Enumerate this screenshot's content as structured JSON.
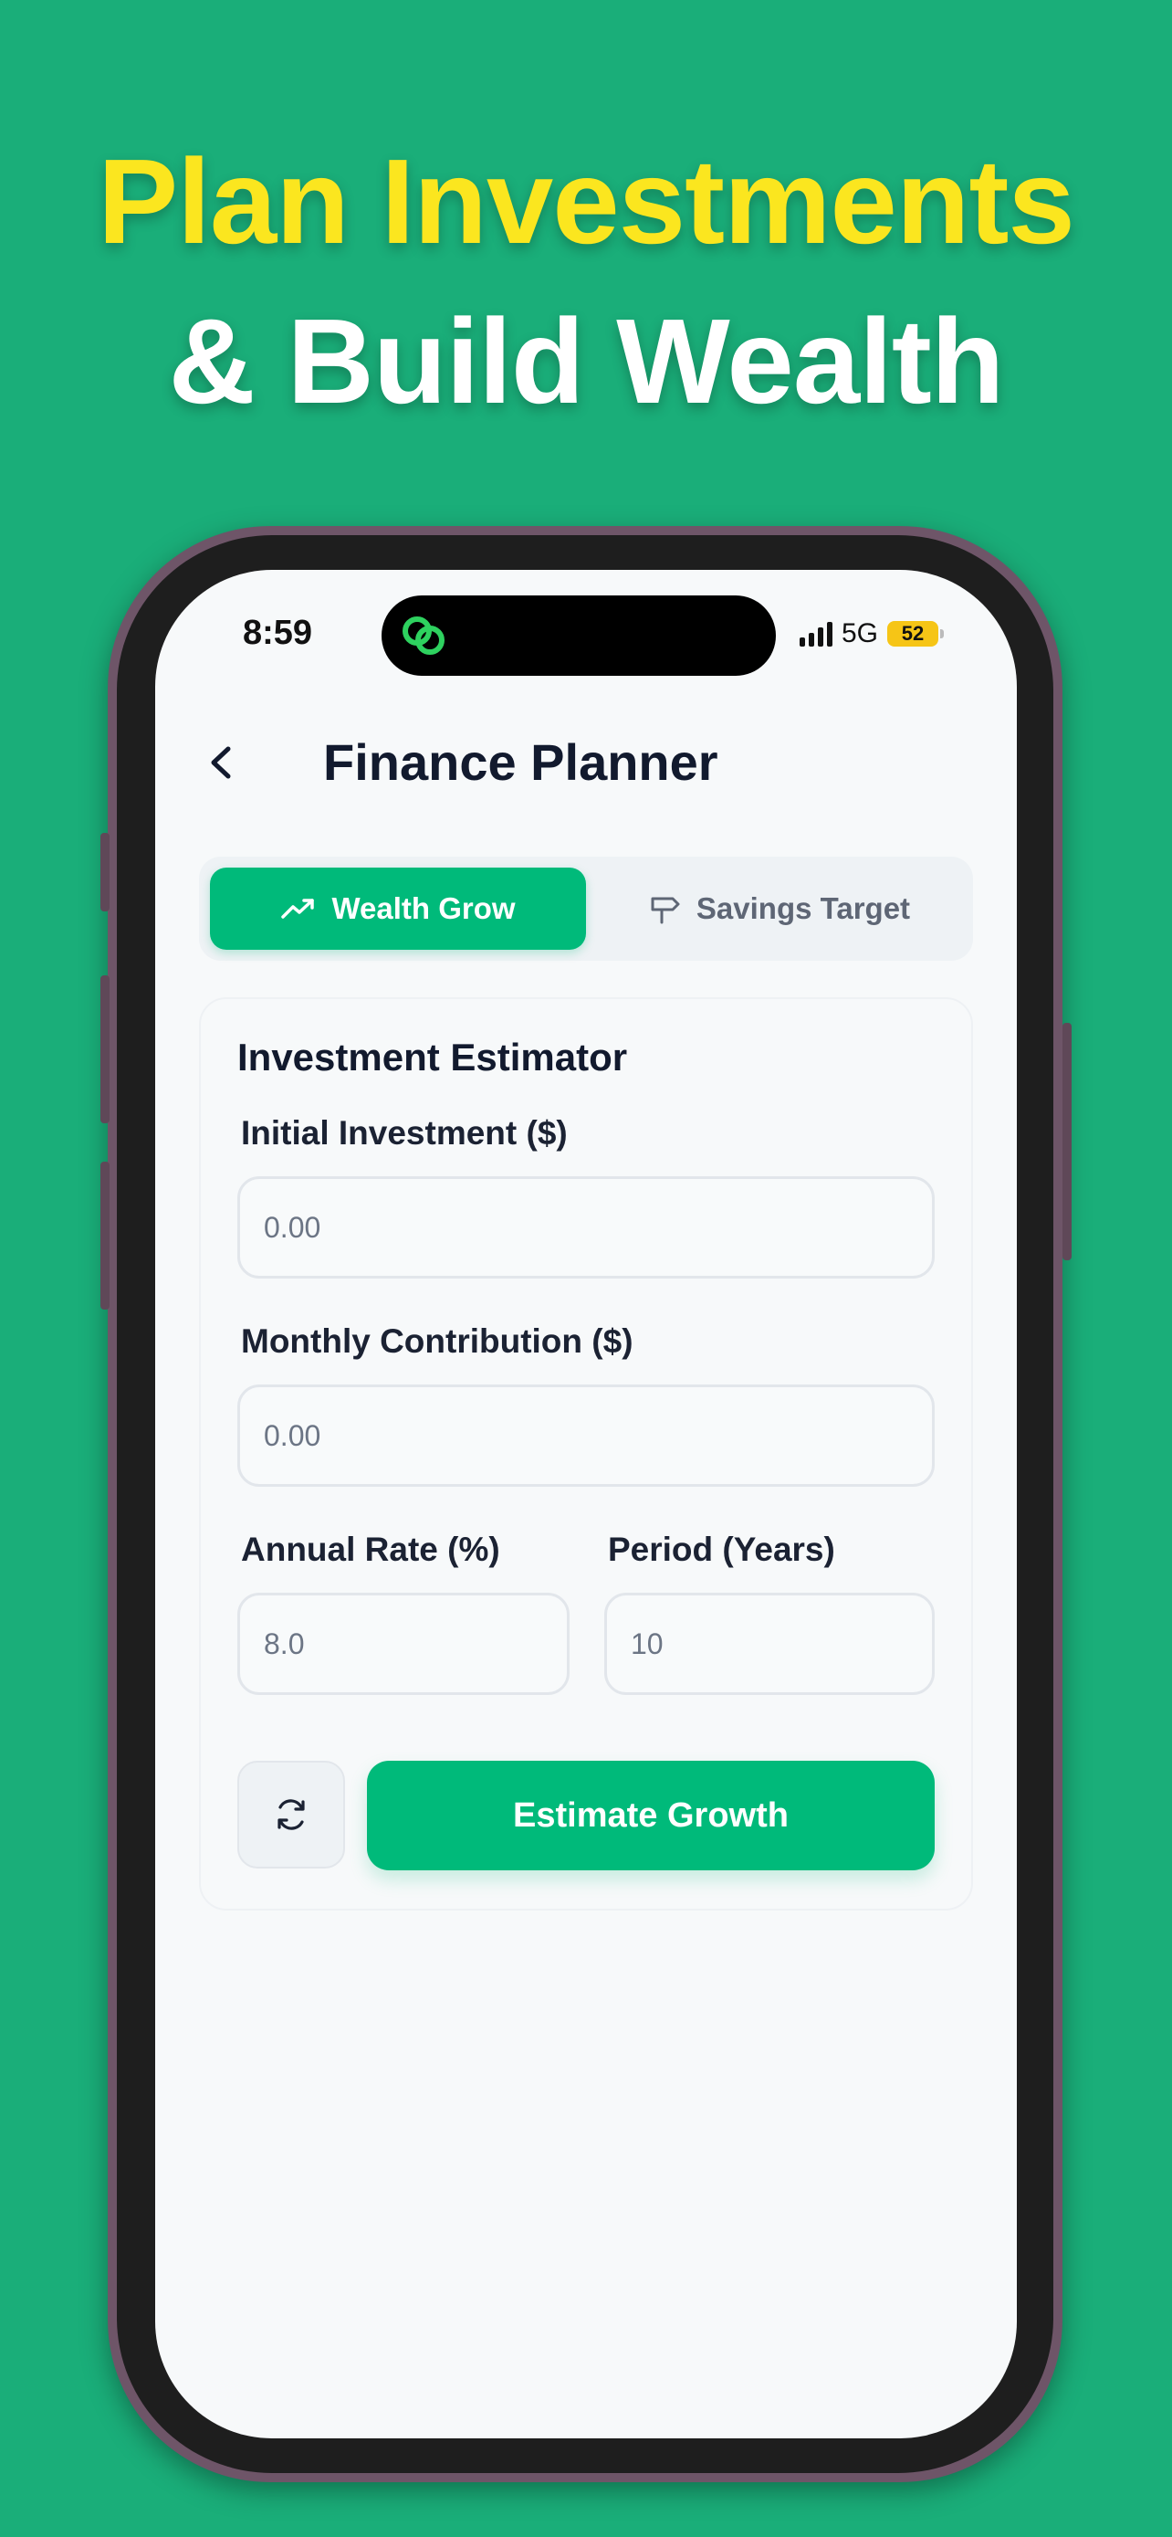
{
  "promo": {
    "headline_line1": "Plan Investments",
    "headline_line2": "& Build Wealth"
  },
  "colors": {
    "background": "#1AAE79",
    "headline_accent": "#FBE61F",
    "primary": "#00BA7A",
    "battery": "#F6C516"
  },
  "status_bar": {
    "time": "8:59",
    "network": "5G",
    "battery": "52",
    "island_icon": "link-rings-icon"
  },
  "header": {
    "back_icon": "chevron-left-icon",
    "title": "Finance Planner"
  },
  "tabs": [
    {
      "label": "Wealth Grow",
      "icon": "trending-up-icon",
      "selected": true
    },
    {
      "label": "Savings Target",
      "icon": "signpost-icon",
      "selected": false
    }
  ],
  "form": {
    "title": "Investment Estimator",
    "initial_investment": {
      "label": "Initial Investment ($)",
      "placeholder": "0.00",
      "value": ""
    },
    "monthly_contribution": {
      "label": "Monthly Contribution ($)",
      "placeholder": "0.00",
      "value": ""
    },
    "annual_rate": {
      "label": "Annual Rate (%)",
      "placeholder": "8.0",
      "value": ""
    },
    "period": {
      "label": "Period (Years)",
      "placeholder": "10",
      "value": ""
    },
    "reset_icon": "refresh-icon",
    "submit_label": "Estimate Growth"
  }
}
